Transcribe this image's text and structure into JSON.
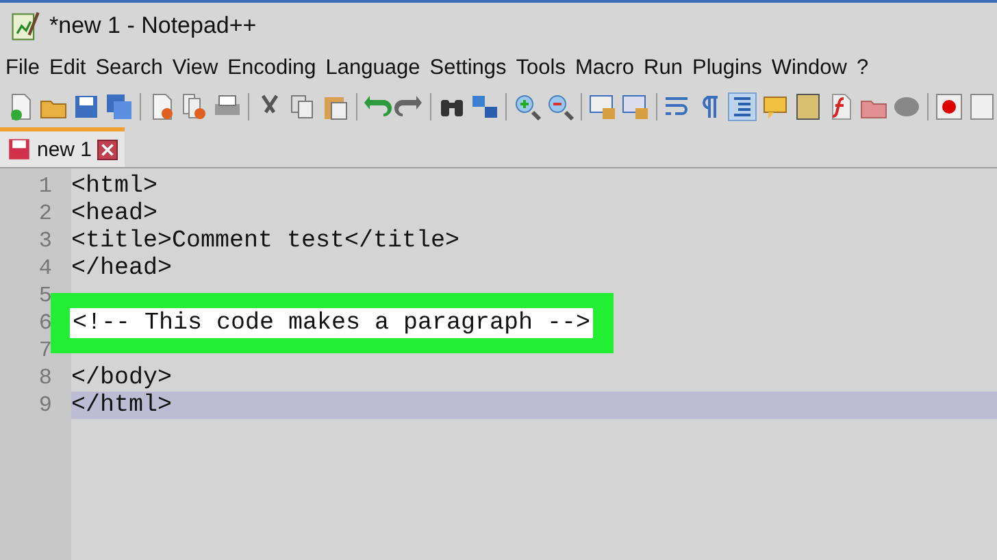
{
  "window": {
    "title": "*new 1 - Notepad++"
  },
  "menu": [
    "File",
    "Edit",
    "Search",
    "View",
    "Encoding",
    "Language",
    "Settings",
    "Tools",
    "Macro",
    "Run",
    "Plugins",
    "Window",
    "?"
  ],
  "tabs": [
    {
      "label": "new 1",
      "selected": true,
      "modified": true
    }
  ],
  "editor": {
    "lines": [
      {
        "number": "1",
        "code": "<html>",
        "current": false,
        "highlight": false
      },
      {
        "number": "2",
        "code": "<head>",
        "current": false,
        "highlight": false
      },
      {
        "number": "3",
        "code": "<title>Comment test</title>",
        "current": false,
        "highlight": false
      },
      {
        "number": "4",
        "code": "</head>",
        "current": false,
        "highlight": false
      },
      {
        "number": "5",
        "current": false,
        "highlight": false
      },
      {
        "number": "6",
        "code": "<!-- This code makes a paragraph -->",
        "current": false,
        "highlight": true
      },
      {
        "number": "7",
        "current": false,
        "highlight": false
      },
      {
        "number": "8",
        "code": "</body>",
        "current": false,
        "highlight": false
      },
      {
        "number": "9",
        "code": "</html>",
        "current": true,
        "highlight": false
      }
    ]
  }
}
